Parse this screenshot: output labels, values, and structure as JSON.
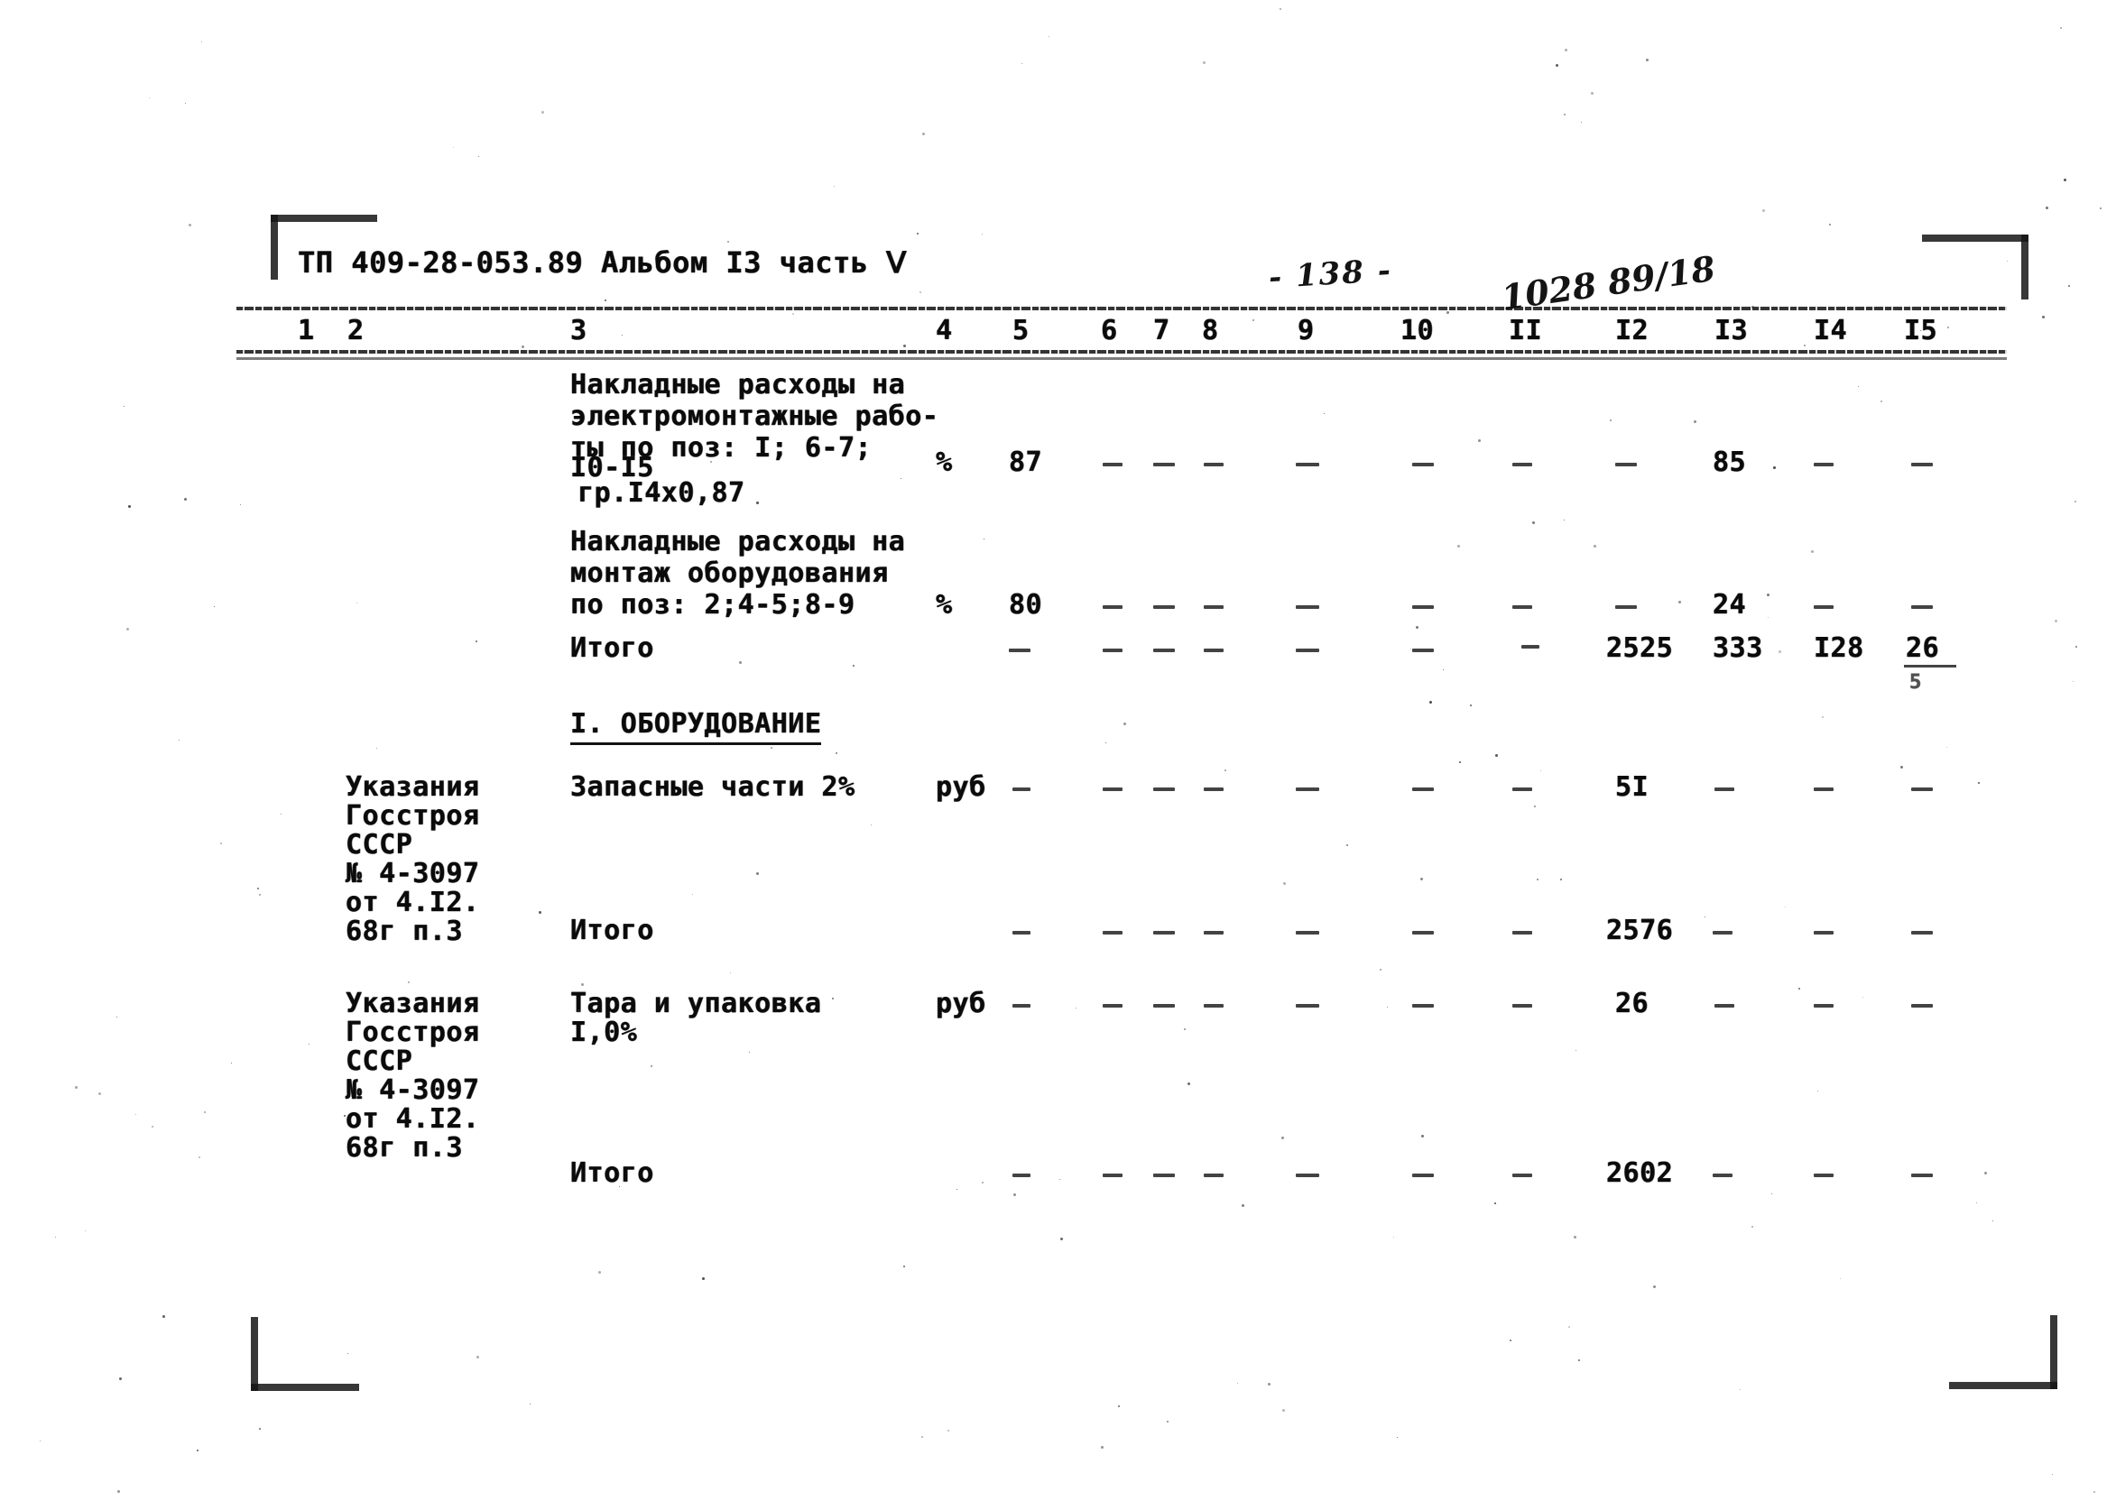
{
  "document": {
    "header_left": "ТП 409-28-053.89 Альбом I3 часть Ⅴ",
    "page_number_handwritten": "- 138 -",
    "archive_mark_handwritten": "1028 89/18"
  },
  "table": {
    "column_numbers": [
      "1",
      "2",
      "3",
      "4",
      "5",
      "6",
      "7",
      "8",
      "9",
      "10",
      "II",
      "I2",
      "I3",
      "I4",
      "I5"
    ],
    "rows": [
      {
        "id": "overhead-electrical",
        "reference": "",
        "description_lines": [
          "Накладные расходы на",
          "электромонтажные рабо-",
          "ты по поз: I; 6-7;",
          "I0-I5",
          "гр.I4х0,87"
        ],
        "unit": "%",
        "col5": "87",
        "col13": "85"
      },
      {
        "id": "overhead-equipment-mounting",
        "reference": "",
        "description_lines": [
          "Накладные расходы на",
          "монтаж оборудования",
          "по поз: 2;4-5;8-9"
        ],
        "unit": "%",
        "col5": "80",
        "col13": "24"
      },
      {
        "id": "subtotal-1",
        "reference": "",
        "description_lines": [
          "Итого"
        ],
        "unit": "",
        "col12": "2525",
        "col13": "333",
        "col14": "I28",
        "col15": "26"
      },
      {
        "id": "section-heading-equipment",
        "reference": "",
        "description_lines": [
          "I. ОБОРУДОВАНИЕ"
        ],
        "unit": ""
      },
      {
        "id": "spare-parts",
        "reference_lines": [
          "Указания",
          "Госстроя",
          "СССР",
          "№ 4-3097",
          "от 4.I2.",
          "68г п.3"
        ],
        "description_lines": [
          "Запасные части 2%"
        ],
        "unit": "руб",
        "col12": "5I"
      },
      {
        "id": "subtotal-2",
        "reference": "",
        "description_lines": [
          "Итого"
        ],
        "unit": "",
        "col12": "2576"
      },
      {
        "id": "packaging",
        "reference_lines": [
          "Указания",
          "Госстроя",
          "СССР",
          "№ 4-3097",
          "от 4.I2.",
          "68г п.3"
        ],
        "description_lines": [
          "Тара и упаковка",
          "I,0%"
        ],
        "unit": "руб",
        "col12": "26"
      },
      {
        "id": "subtotal-3",
        "reference": "",
        "description_lines": [
          "Итого"
        ],
        "unit": "",
        "col12": "2602"
      }
    ]
  },
  "colors": {
    "ink": "#0b0b0b",
    "paper": "#ffffff",
    "rule": "#111111"
  }
}
